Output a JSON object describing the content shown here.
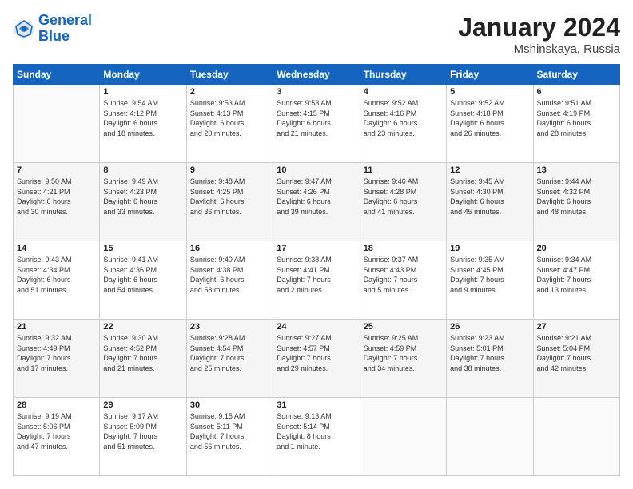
{
  "header": {
    "logo_line1": "General",
    "logo_line2": "Blue",
    "month_title": "January 2024",
    "location": "Mshinskaya, Russia"
  },
  "weekdays": [
    "Sunday",
    "Monday",
    "Tuesday",
    "Wednesday",
    "Thursday",
    "Friday",
    "Saturday"
  ],
  "weeks": [
    [
      {
        "day": "",
        "info": ""
      },
      {
        "day": "1",
        "info": "Sunrise: 9:54 AM\nSunset: 4:12 PM\nDaylight: 6 hours\nand 18 minutes."
      },
      {
        "day": "2",
        "info": "Sunrise: 9:53 AM\nSunset: 4:13 PM\nDaylight: 6 hours\nand 20 minutes."
      },
      {
        "day": "3",
        "info": "Sunrise: 9:53 AM\nSunset: 4:15 PM\nDaylight: 6 hours\nand 21 minutes."
      },
      {
        "day": "4",
        "info": "Sunrise: 9:52 AM\nSunset: 4:16 PM\nDaylight: 6 hours\nand 23 minutes."
      },
      {
        "day": "5",
        "info": "Sunrise: 9:52 AM\nSunset: 4:18 PM\nDaylight: 6 hours\nand 26 minutes."
      },
      {
        "day": "6",
        "info": "Sunrise: 9:51 AM\nSunset: 4:19 PM\nDaylight: 6 hours\nand 28 minutes."
      }
    ],
    [
      {
        "day": "7",
        "info": "Sunrise: 9:50 AM\nSunset: 4:21 PM\nDaylight: 6 hours\nand 30 minutes."
      },
      {
        "day": "8",
        "info": "Sunrise: 9:49 AM\nSunset: 4:23 PM\nDaylight: 6 hours\nand 33 minutes."
      },
      {
        "day": "9",
        "info": "Sunrise: 9:48 AM\nSunset: 4:25 PM\nDaylight: 6 hours\nand 36 minutes."
      },
      {
        "day": "10",
        "info": "Sunrise: 9:47 AM\nSunset: 4:26 PM\nDaylight: 6 hours\nand 39 minutes."
      },
      {
        "day": "11",
        "info": "Sunrise: 9:46 AM\nSunset: 4:28 PM\nDaylight: 6 hours\nand 41 minutes."
      },
      {
        "day": "12",
        "info": "Sunrise: 9:45 AM\nSunset: 4:30 PM\nDaylight: 6 hours\nand 45 minutes."
      },
      {
        "day": "13",
        "info": "Sunrise: 9:44 AM\nSunset: 4:32 PM\nDaylight: 6 hours\nand 48 minutes."
      }
    ],
    [
      {
        "day": "14",
        "info": "Sunrise: 9:43 AM\nSunset: 4:34 PM\nDaylight: 6 hours\nand 51 minutes."
      },
      {
        "day": "15",
        "info": "Sunrise: 9:41 AM\nSunset: 4:36 PM\nDaylight: 6 hours\nand 54 minutes."
      },
      {
        "day": "16",
        "info": "Sunrise: 9:40 AM\nSunset: 4:38 PM\nDaylight: 6 hours\nand 58 minutes."
      },
      {
        "day": "17",
        "info": "Sunrise: 9:38 AM\nSunset: 4:41 PM\nDaylight: 7 hours\nand 2 minutes."
      },
      {
        "day": "18",
        "info": "Sunrise: 9:37 AM\nSunset: 4:43 PM\nDaylight: 7 hours\nand 5 minutes."
      },
      {
        "day": "19",
        "info": "Sunrise: 9:35 AM\nSunset: 4:45 PM\nDaylight: 7 hours\nand 9 minutes."
      },
      {
        "day": "20",
        "info": "Sunrise: 9:34 AM\nSunset: 4:47 PM\nDaylight: 7 hours\nand 13 minutes."
      }
    ],
    [
      {
        "day": "21",
        "info": "Sunrise: 9:32 AM\nSunset: 4:49 PM\nDaylight: 7 hours\nand 17 minutes."
      },
      {
        "day": "22",
        "info": "Sunrise: 9:30 AM\nSunset: 4:52 PM\nDaylight: 7 hours\nand 21 minutes."
      },
      {
        "day": "23",
        "info": "Sunrise: 9:28 AM\nSunset: 4:54 PM\nDaylight: 7 hours\nand 25 minutes."
      },
      {
        "day": "24",
        "info": "Sunrise: 9:27 AM\nSunset: 4:57 PM\nDaylight: 7 hours\nand 29 minutes."
      },
      {
        "day": "25",
        "info": "Sunrise: 9:25 AM\nSunset: 4:59 PM\nDaylight: 7 hours\nand 34 minutes."
      },
      {
        "day": "26",
        "info": "Sunrise: 9:23 AM\nSunset: 5:01 PM\nDaylight: 7 hours\nand 38 minutes."
      },
      {
        "day": "27",
        "info": "Sunrise: 9:21 AM\nSunset: 5:04 PM\nDaylight: 7 hours\nand 42 minutes."
      }
    ],
    [
      {
        "day": "28",
        "info": "Sunrise: 9:19 AM\nSunset: 5:06 PM\nDaylight: 7 hours\nand 47 minutes."
      },
      {
        "day": "29",
        "info": "Sunrise: 9:17 AM\nSunset: 5:09 PM\nDaylight: 7 hours\nand 51 minutes."
      },
      {
        "day": "30",
        "info": "Sunrise: 9:15 AM\nSunset: 5:11 PM\nDaylight: 7 hours\nand 56 minutes."
      },
      {
        "day": "31",
        "info": "Sunrise: 9:13 AM\nSunset: 5:14 PM\nDaylight: 8 hours\nand 1 minute."
      },
      {
        "day": "",
        "info": ""
      },
      {
        "day": "",
        "info": ""
      },
      {
        "day": "",
        "info": ""
      }
    ]
  ]
}
